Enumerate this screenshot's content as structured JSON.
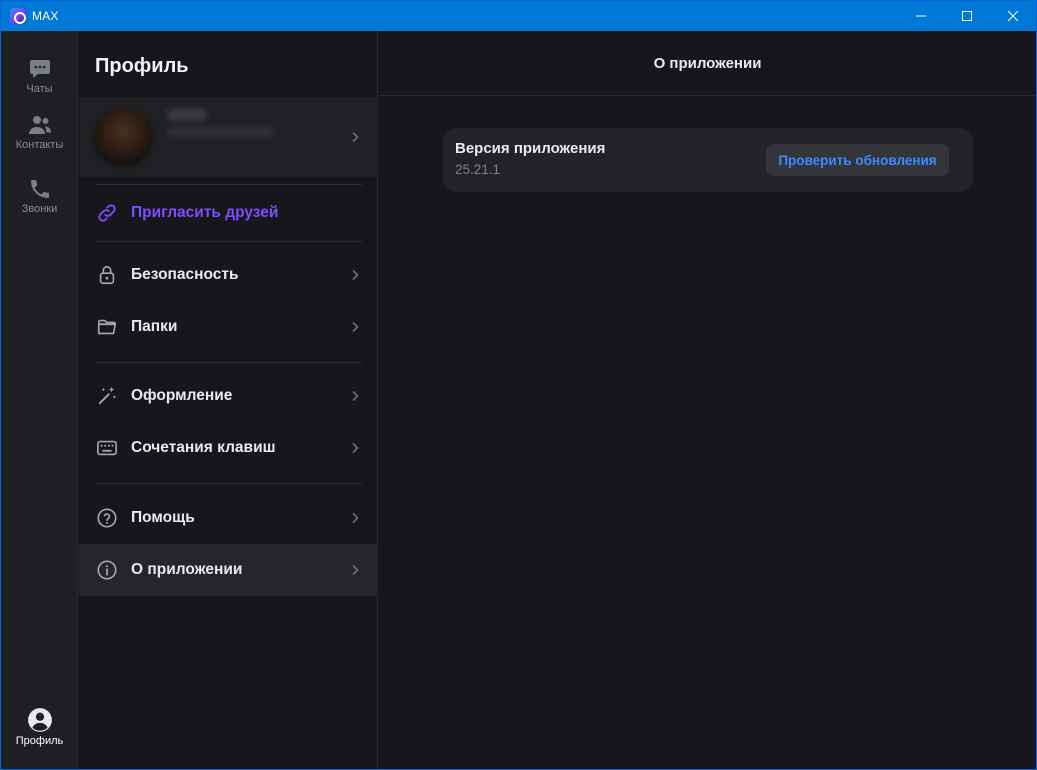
{
  "window": {
    "title": "MAX"
  },
  "rail": {
    "items": [
      {
        "label": "Чаты",
        "icon": "chat-icon"
      },
      {
        "label": "Контакты",
        "icon": "contacts-icon"
      },
      {
        "label": "Звонки",
        "icon": "phone-icon"
      }
    ],
    "profile": {
      "label": "Профиль",
      "icon": "user-avatar-icon"
    }
  },
  "middle": {
    "title": "Профиль",
    "menu": [
      {
        "label": "Пригласить друзей",
        "icon": "link-icon"
      },
      {
        "label": "Безопасность",
        "icon": "lock-icon"
      },
      {
        "label": "Папки",
        "icon": "folder-icon"
      },
      {
        "label": "Оформление",
        "icon": "magic-wand-icon"
      },
      {
        "label": "Сочетания клавиш",
        "icon": "keyboard-icon"
      },
      {
        "label": "Помощь",
        "icon": "help-icon"
      },
      {
        "label": "О приложении",
        "icon": "info-icon"
      }
    ]
  },
  "content": {
    "title": "О приложении",
    "version_label": "Версия приложения",
    "version_value": "25.21.1",
    "check_button": "Проверить обновления"
  },
  "colors": {
    "accent_purple": "#7d4dff",
    "accent_blue": "#3d8bff",
    "titlebar": "#0078d7"
  }
}
